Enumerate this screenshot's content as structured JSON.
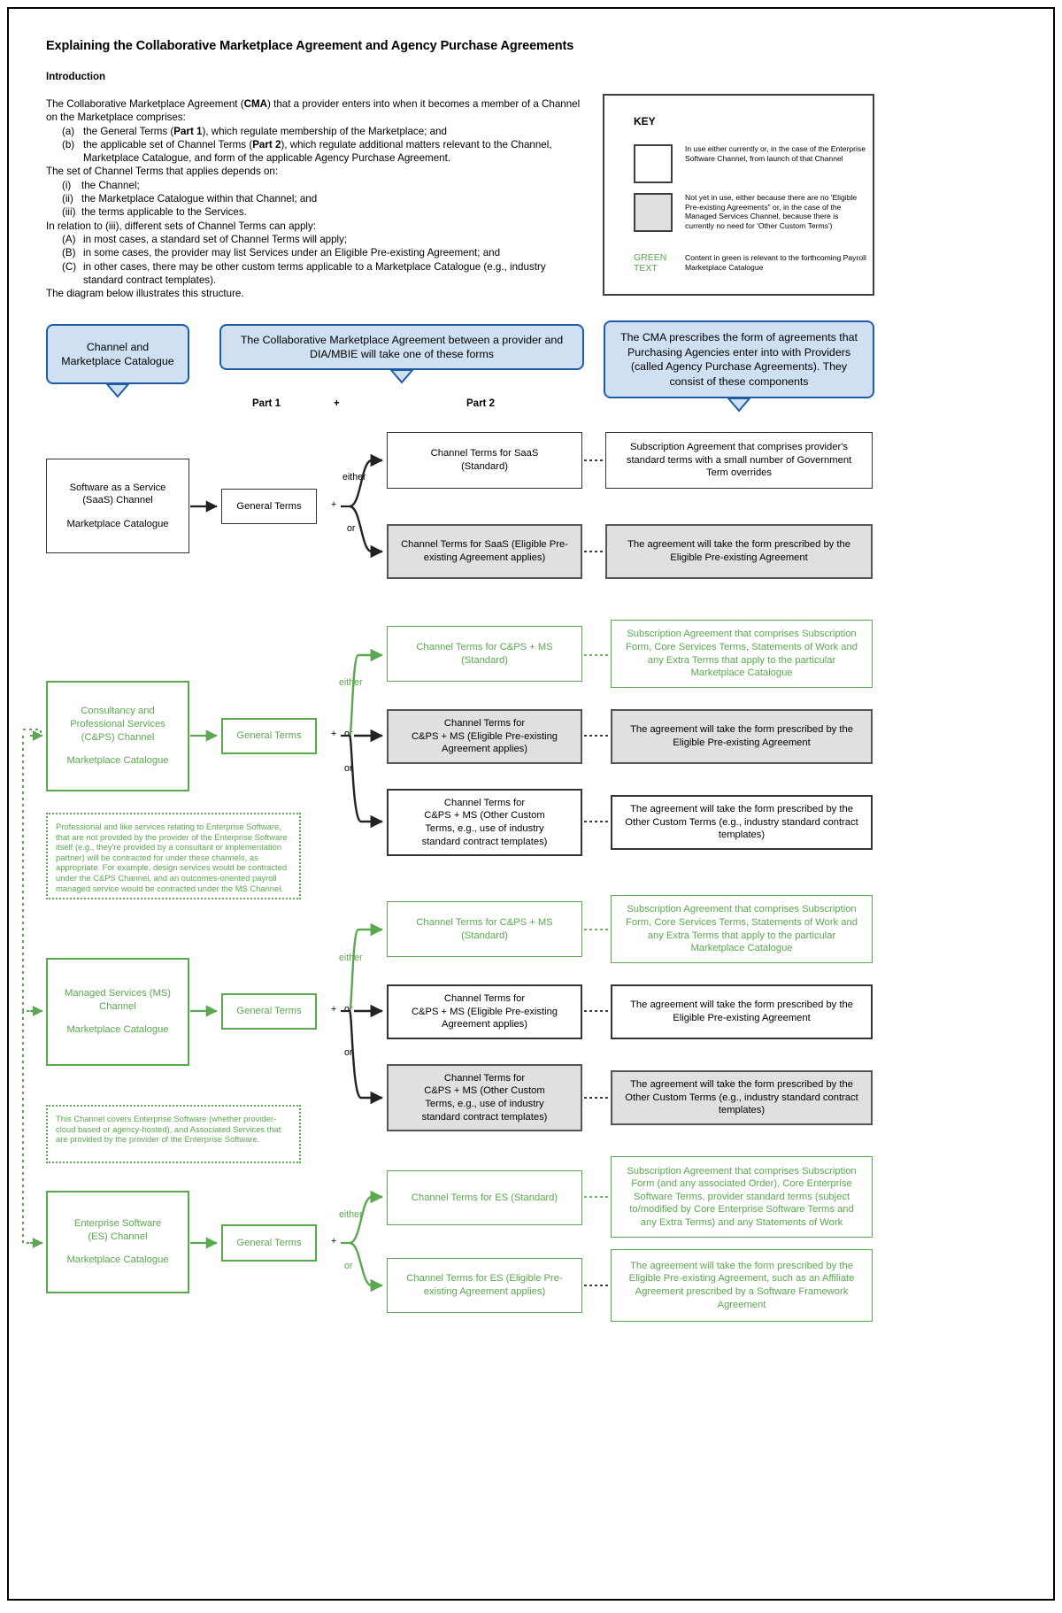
{
  "document": {
    "title": "Explaining the Collaborative Marketplace Agreement and Agency Purchase Agreements",
    "section_heading": "Introduction",
    "intro": {
      "p1_a": "The Collaborative Marketplace Agreement (",
      "p1_b": "CMA",
      "p1_c": ") that a provider enters into when it becomes a member of a Channel on the Marketplace comprises:",
      "list1": [
        {
          "marker": "(a)",
          "text_a": "the General Terms (",
          "bold": "Part 1",
          "text_b": "), which regulate membership of the Marketplace; and"
        },
        {
          "marker": "(b)",
          "text_a": "the applicable set of Channel Terms (",
          "bold": "Part 2",
          "text_b": "), which regulate additional matters relevant to the Channel, Marketplace Catalogue, and form of the applicable Agency Purchase Agreement."
        }
      ],
      "p2": "The set of Channel Terms that applies depends on:",
      "list2": [
        {
          "marker": "(i)",
          "text": "the Channel;"
        },
        {
          "marker": "(ii)",
          "text": "the Marketplace Catalogue within that Channel; and"
        },
        {
          "marker": "(iii)",
          "text": "the terms applicable to the Services."
        }
      ],
      "p3": "In relation to (iii), different sets of Channel Terms can apply:",
      "list3": [
        {
          "marker": "(A)",
          "text": "in most cases, a standard set of Channel Terms will apply;"
        },
        {
          "marker": "(B)",
          "text": "in some cases, the provider may list Services under an Eligible Pre-existing Agreement; and"
        },
        {
          "marker": "(C)",
          "text": "in other cases, there may be other custom terms applicable to a Marketplace Catalogue (e.g., industry standard contract templates)."
        }
      ],
      "p4": "The diagram below illustrates this structure."
    }
  },
  "key": {
    "title": "KEY",
    "items": [
      {
        "swatch": "white",
        "text": "In use either currently or, in the case of the Enterprise Software Channel, from launch of that Channel"
      },
      {
        "swatch": "grey",
        "text": "Not yet in use, either because there are no 'Eligible Pre-existing Agreements\" or, in the case of the Managed Services Channel, because there is currently no need for 'Other Custom Terms')"
      },
      {
        "swatch": "green-text",
        "label": "GREEN TEXT",
        "text": "Content in green is relevant to the forthcoming Payroll Marketplace Catalogue"
      }
    ]
  },
  "callouts": {
    "left": "Channel and\nMarketplace Catalogue",
    "middle": "The Collaborative Marketplace Agreement between a provider and DIA/MBIE will take one of these forms",
    "right": "The CMA prescribes the form of agreements that Purchasing Agencies enter into with Providers (called Agency Purchase Agreements). They consist of these components"
  },
  "column_labels": {
    "part1": "Part 1",
    "plus": "+",
    "part2": "Part 2"
  },
  "connector_labels": {
    "either": "either",
    "or": "or",
    "plus": "+"
  },
  "general_terms": "General Terms",
  "channels": [
    {
      "id": "saas",
      "name_lines": [
        "Software as a Service",
        "(SaaS) Channel"
      ],
      "catalogue": "Marketplace Catalogue",
      "green": false,
      "branches": [
        {
          "label": "either",
          "style": "white",
          "terms": "Channel Terms for SaaS\n(Standard)",
          "agreement": "Subscription Agreement that comprises provider's standard terms with a small number of Government Term overrides",
          "agreement_style": "white"
        },
        {
          "label": "or",
          "style": "grey",
          "terms": "Channel Terms for SaaS (Eligible Pre-existing Agreement applies)",
          "agreement": "The agreement will take the form prescribed by the Eligible Pre-existing Agreement",
          "agreement_style": "grey"
        }
      ]
    },
    {
      "id": "cps",
      "name_lines": [
        "Consultancy and",
        "Professional Services",
        "(C&PS) Channel"
      ],
      "catalogue": "Marketplace Catalogue",
      "green": true,
      "branches": [
        {
          "label": "either",
          "style": "green",
          "terms": "Channel Terms for C&PS + MS\n(Standard)",
          "agreement": "Subscription Agreement that comprises Subscription Form, Core Services Terms, Statements of Work and any Extra Terms that apply to the particular Marketplace Catalogue",
          "agreement_style": "green"
        },
        {
          "label": "or",
          "style": "grey",
          "terms": "Channel Terms for\nC&PS + MS (Eligible Pre-existing\nAgreement applies)",
          "agreement": "The agreement will take the form prescribed by the Eligible Pre-existing Agreement",
          "agreement_style": "grey"
        },
        {
          "label": "or",
          "style": "white",
          "terms": "Channel Terms for\nC&PS + MS (Other Custom\nTerms, e.g., use of industry\nstandard contract templates)",
          "agreement": "The agreement will take the form prescribed by the Other Custom Terms (e.g., industry standard contract templates)",
          "agreement_style": "white"
        }
      ]
    },
    {
      "id": "ms",
      "name_lines": [
        "Managed Services (MS)",
        "Channel"
      ],
      "catalogue": "Marketplace Catalogue",
      "green": true,
      "branches": [
        {
          "label": "either",
          "style": "green",
          "terms": "Channel Terms for C&PS + MS\n(Standard)",
          "agreement": "Subscription Agreement that comprises Subscription Form, Core Services Terms, Statements of Work and any Extra Terms that apply to the particular Marketplace Catalogue",
          "agreement_style": "green"
        },
        {
          "label": "or",
          "style": "white",
          "terms": "Channel Terms for\nC&PS + MS (Eligible Pre-existing\nAgreement applies)",
          "agreement": "The agreement will take the form prescribed by the Eligible Pre-existing Agreement",
          "agreement_style": "white"
        },
        {
          "label": "or",
          "style": "grey",
          "terms": "Channel Terms for\nC&PS + MS (Other Custom\nTerms, e.g., use of industry\nstandard contract templates)",
          "agreement": "The agreement will take the form prescribed by the Other Custom Terms (e.g., industry standard contract templates)",
          "agreement_style": "grey"
        }
      ]
    },
    {
      "id": "es",
      "name_lines": [
        "Enterprise Software",
        "(ES) Channel"
      ],
      "catalogue": "Marketplace Catalogue",
      "green": true,
      "branches": [
        {
          "label": "either",
          "style": "green",
          "terms": "Channel Terms for ES (Standard)",
          "agreement": "Subscription Agreement that comprises Subscription Form (and any associated Order), Core Enterprise Software Terms, provider standard terms (subject to/modified by Core Enterprise Software Terms and any Extra Terms) and any Statements of Work",
          "agreement_style": "green"
        },
        {
          "label": "or",
          "style": "green",
          "terms": "Channel Terms for ES (Eligible Pre-existing Agreement applies)",
          "agreement": "The agreement will take the form prescribed by the Eligible Pre-existing Agreement, such as an Affiliate Agreement prescribed by a Software Framework Agreement",
          "agreement_style": "green"
        }
      ]
    }
  ],
  "notes": [
    {
      "id": "note-cps-ms",
      "text": "Professional and like services relating to Enterprise Software, that are not provided by the provider of the Enterprise Software itself (e.g., they're provided by a consultant or implementation partner) will be contracted for under these channels, as appropriate. For example, design services would be contracted under the C&PS Channel, and an outcomes-oriented payroll managed service would be contracted under the MS Channel."
    },
    {
      "id": "note-es",
      "text": "This Channel covers Enterprise Software (whether provider-cloud based or agency-hosted), and Associated Services that are provided by the provider of the Enterprise Software."
    }
  ],
  "colors": {
    "green": "#5aa84f",
    "blue_fill": "#cfe0f3",
    "blue_border": "#1f5ca8",
    "grey_fill": "#e0e0e0",
    "dark": "#333333"
  }
}
